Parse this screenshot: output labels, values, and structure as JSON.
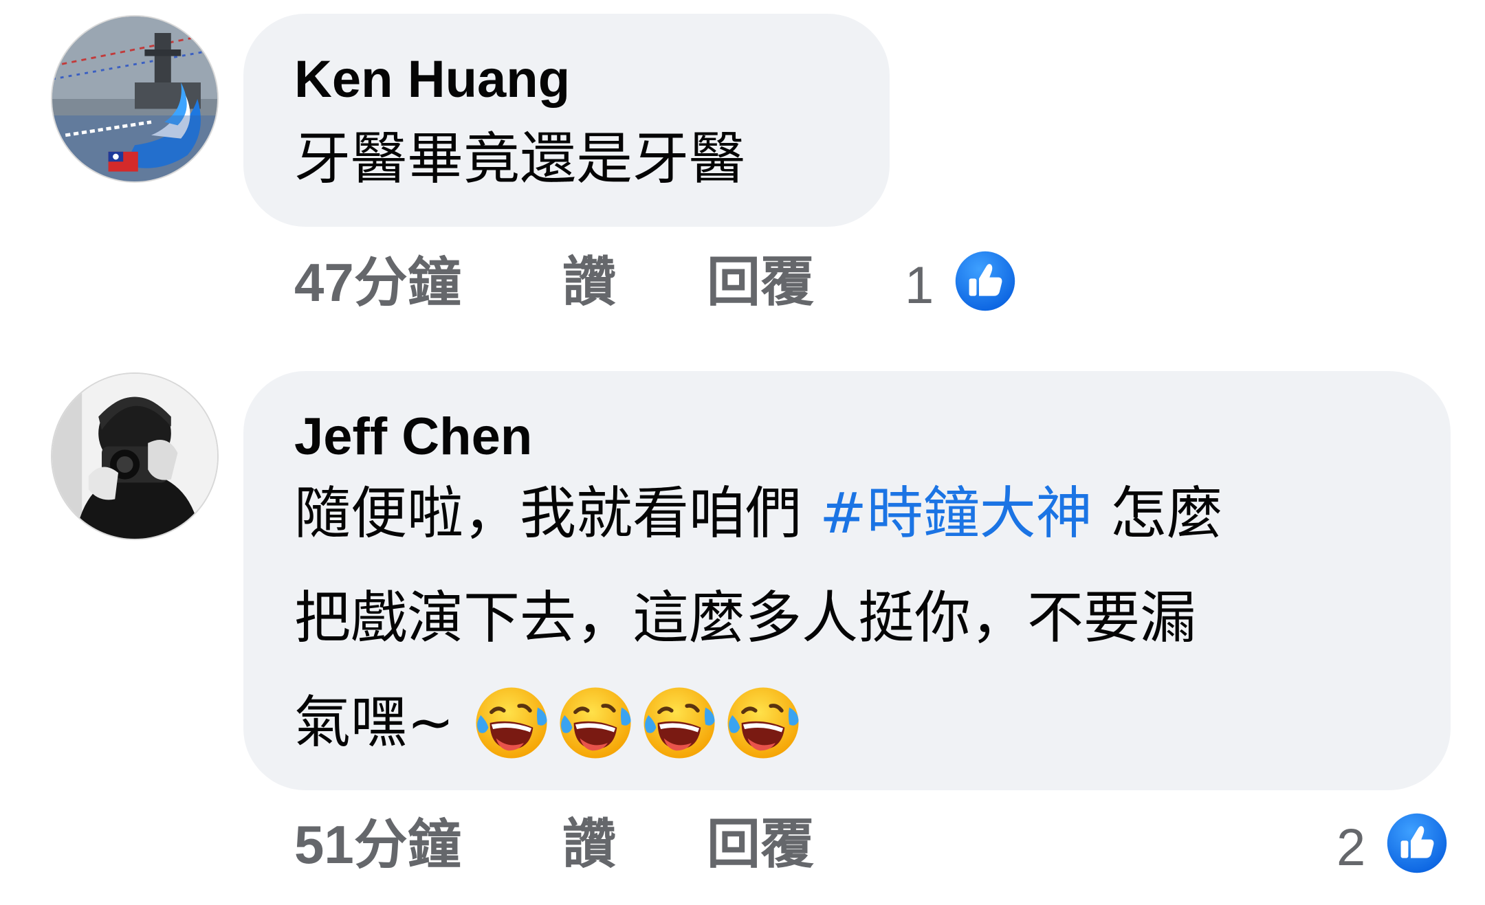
{
  "comments": [
    {
      "author": "Ken Huang",
      "text": "牙醫畢竟還是牙醫",
      "avatar_icon": "navy-avatar-icon",
      "time": "47分鐘",
      "like_label": "讚",
      "reply_label": "回覆",
      "reaction_count": "1",
      "reaction_icon": "like-reaction-icon"
    },
    {
      "author": "Jeff Chen",
      "text_line1_before": "隨便啦，我就看咱們 ",
      "hashtag": "#時鐘大神",
      "text_line1_after": " 怎麼",
      "text_line2": "把戲演下去，這麼多人挺你，不要漏",
      "text_line3": "氣嘿~",
      "emojis": [
        "face-with-tears-of-joy-icon",
        "face-with-tears-of-joy-icon",
        "face-with-tears-of-joy-icon",
        "face-with-tears-of-joy-icon"
      ],
      "avatar_icon": "photographer-avatar-icon",
      "time": "51分鐘",
      "like_label": "讚",
      "reply_label": "回覆",
      "reaction_count": "2",
      "reaction_icon": "like-reaction-icon"
    }
  ],
  "colors": {
    "bubble": "#f0f2f5",
    "meta_text": "#65676b",
    "hashtag": "#1b74e4",
    "like_blue": "#1877f2"
  }
}
